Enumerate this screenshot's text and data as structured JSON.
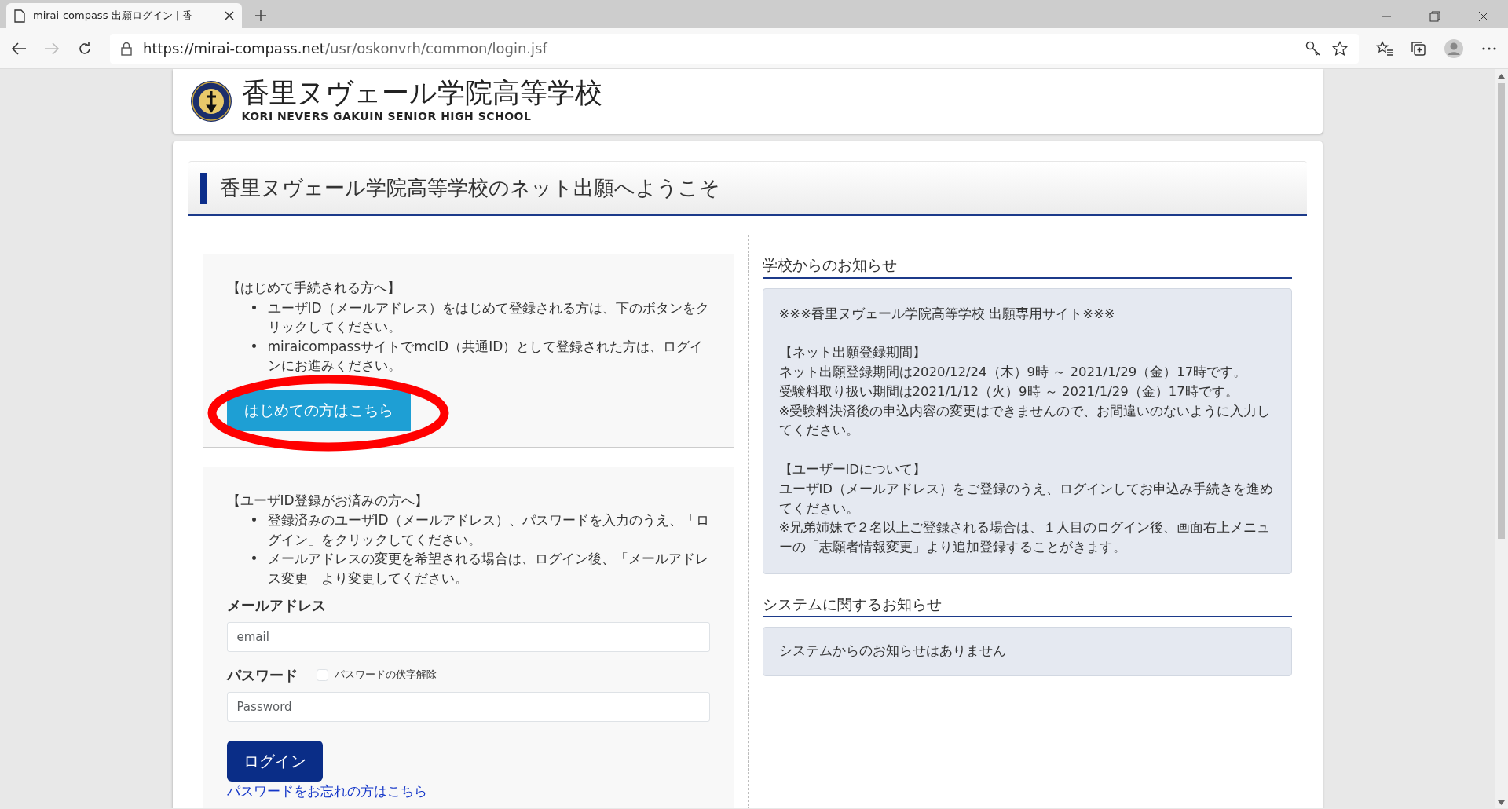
{
  "browser": {
    "tab_title": "mirai-compass 出願ログイン | 香",
    "url_host": "https://mirai-compass.net",
    "url_path": "/usr/oskonvrh/common/login.jsf"
  },
  "header": {
    "school_name": "香里ヌヴェール学院高等学校",
    "school_name_en": "KORI NEVERS GAKUIN SENIOR HIGH SCHOOL"
  },
  "welcome_title": "香里ヌヴェール学院高等学校のネット出願へようこそ",
  "first_time": {
    "heading": "【はじめて手続される方へ】",
    "bullets": [
      "ユーザID（メールアドレス）をはじめて登録される方は、下のボタンをクリックしてください。",
      "miraicompassサイトでmcID（共通ID）として登録された方は、ログインにお進みください。"
    ],
    "bullet_mark": "•",
    "button": "はじめての方はこちら",
    "circled": true
  },
  "registered": {
    "heading": "【ユーザID登録がお済みの方へ】",
    "bullets": [
      "登録済みのユーザID（メールアドレス）、パスワードを入力のうえ、「ログイン」をクリックしてください。",
      "メールアドレスの変更を希望される場合は、ログイン後、「メールアドレス変更」より変更してください。"
    ],
    "bullet_mark": "•",
    "email_label": "メールアドレス",
    "email_placeholder": "email",
    "password_label": "パスワード",
    "unmask_label": "パスワードの伏字解除",
    "unmask_checked": false,
    "password_placeholder": "Password",
    "login_button": "ログイン",
    "forgot_link": "パスワードをお忘れの方はこちら"
  },
  "school_notice": {
    "heading": "学校からのお知らせ",
    "paragraphs": [
      [
        "※※※香里ヌヴェール学院高等学校 出願専用サイト※※※"
      ],
      [
        "【ネット出願登録期間】",
        "ネット出願登録期間は2020/12/24（木）9時 ～ 2021/1/29（金）17時です。",
        "受験料取り扱い期間は2021/1/12（火）9時 ～ 2021/1/29（金）17時です。",
        "※受験料決済後の申込内容の変更はできませんので、お間違いのないように入力してください。"
      ],
      [
        "【ユーザーIDについて】",
        "ユーザID（メールアドレス）をご登録のうえ、ログインしてお申込み手続きを進めてください。",
        "※兄弟姉妹で２名以上ご登録される場合は、１人目のログイン後、画面右上メニューの「志願者情報変更」より追加登録することがきます。"
      ]
    ]
  },
  "system_notice": {
    "heading": "システムに関するお知らせ",
    "text": "システムからのお知らせはありません"
  }
}
